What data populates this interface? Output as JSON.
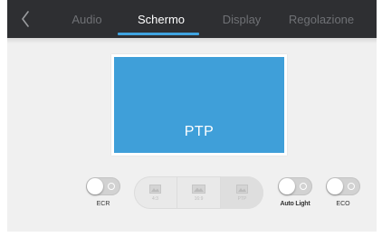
{
  "tabs": [
    {
      "label": "Audio",
      "active": false
    },
    {
      "label": "Schermo",
      "active": true
    },
    {
      "label": "Display",
      "active": false
    },
    {
      "label": "Regolazione",
      "active": false
    }
  ],
  "preview": {
    "label": "PTP",
    "color": "#3f9fd9"
  },
  "toggles": [
    {
      "label": "ECR",
      "state": "off"
    },
    {
      "label": "Auto Light",
      "state": "off"
    },
    {
      "label": "ECO",
      "state": "off"
    }
  ],
  "aspect_options": [
    {
      "label": "4:3",
      "icon": "image-icon",
      "selected": false
    },
    {
      "label": "16:9",
      "icon": "image-icon",
      "selected": false
    },
    {
      "label": "PTP",
      "icon": "image-icon",
      "selected": true
    }
  ],
  "colors": {
    "topbar": "#2e2f32",
    "accent": "#3fa3e0",
    "panel": "#f0f0f0",
    "tab_inactive": "#6f7175",
    "tab_active": "#ffffff"
  }
}
